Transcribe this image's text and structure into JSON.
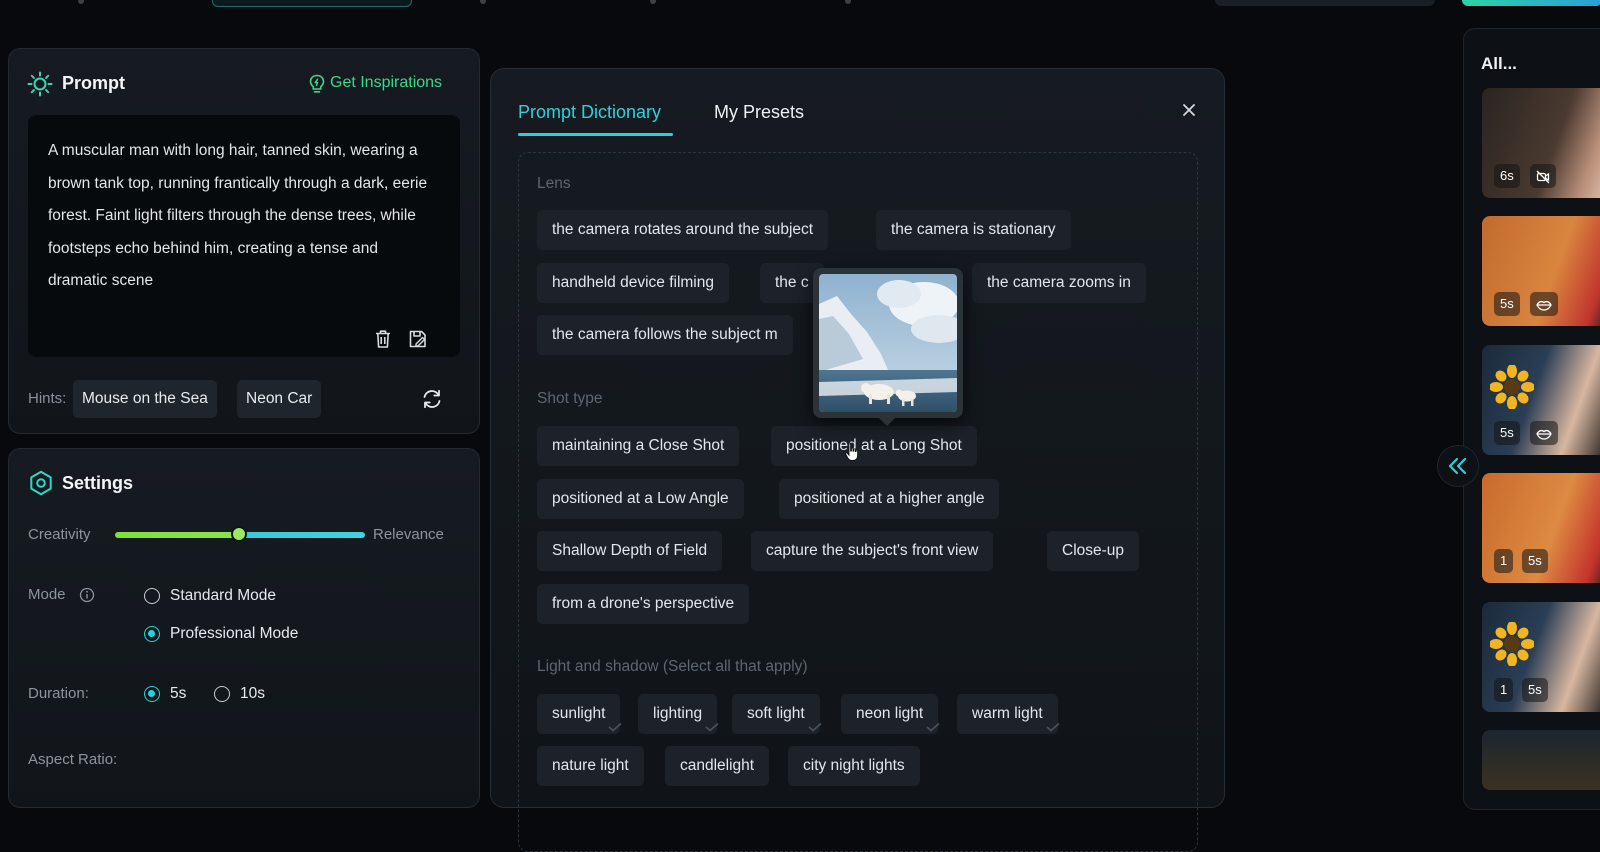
{
  "prompt_panel": {
    "title": "Prompt",
    "inspire_label": "Get Inspirations",
    "text": "A muscular man with long hair, tanned skin, wearing a brown tank top, running frantically through a dark, eerie forest. Faint light filters through the dense trees, while footsteps echo behind him, creating a tense and dramatic scene",
    "hints_label": "Hints:",
    "hints": [
      "Mouse on the Sea",
      "Neon Car"
    ]
  },
  "settings": {
    "title": "Settings",
    "slider_left": "Creativity",
    "slider_right": "Relevance",
    "slider_value": 0.5,
    "mode_label": "Mode",
    "modes": [
      "Standard Mode",
      "Professional Mode"
    ],
    "mode_selected": "Professional Mode",
    "duration_label": "Duration:",
    "durations": [
      "5s",
      "10s"
    ],
    "duration_selected": "5s",
    "aspect_label": "Aspect Ratio:"
  },
  "dictionary": {
    "tabs": [
      "Prompt Dictionary",
      "My Presets"
    ],
    "active_tab": "Prompt Dictionary",
    "lens_label": "Lens",
    "lens": [
      "the camera rotates around the subject",
      "the camera is stationary",
      "handheld device filming",
      "the c",
      "the camera zooms in",
      "the camera follows the subject m"
    ],
    "shot_label": "Shot type",
    "shot": [
      "maintaining a Close Shot",
      "positioned at a Long Shot",
      "positioned at a Low Angle",
      "positioned at a higher angle",
      "Shallow Depth of Field",
      "capture the subject's front view",
      "Close-up",
      "from a drone's perspective"
    ],
    "light_label": "Light and shadow (Select all that apply)",
    "light": [
      "sunlight",
      "lighting",
      "soft light",
      "neon light",
      "warm light",
      "nature light",
      "candlelight",
      "city night lights"
    ]
  },
  "gallery": {
    "title": "All...",
    "items": [
      {
        "badges": [
          "6s"
        ]
      },
      {
        "badges": [
          "5s"
        ]
      },
      {
        "badges": [
          "5s"
        ]
      },
      {
        "badges": [
          "1",
          "5s"
        ]
      },
      {
        "badges": [
          "1",
          "5s"
        ]
      }
    ]
  },
  "colors": {
    "accent": "#27d3d9",
    "inspire": "#39d98a",
    "background": "#07090c"
  }
}
